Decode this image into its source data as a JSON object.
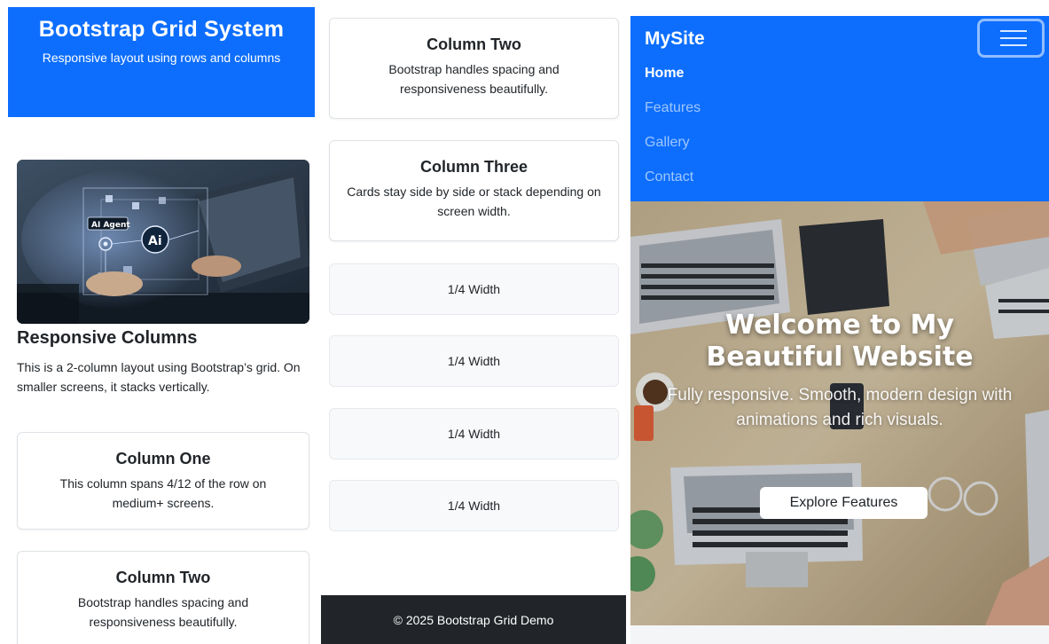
{
  "panel1": {
    "header": {
      "title": "Bootstrap Grid System",
      "subtitle": "Responsive layout using rows and columns"
    },
    "section": {
      "image_labels": [
        "AI Agent",
        "Ai"
      ],
      "title": "Responsive Columns",
      "description": "This is a 2-column layout using Bootstrap’s grid. On smaller screens, it stacks vertically."
    },
    "cards": [
      {
        "title": "Column One",
        "text": "This column spans 4/12 of the row on medium+ screens."
      },
      {
        "title": "Column Two",
        "text": "Bootstrap handles spacing and responsiveness beautifully."
      }
    ]
  },
  "panel2": {
    "cards": [
      {
        "title": "Column Two",
        "text": "Bootstrap handles spacing and responsiveness beautifully."
      },
      {
        "title": "Column Three",
        "text": "Cards stay side by side or stack depending on screen width."
      }
    ],
    "quarters": [
      "1/4 Width",
      "1/4 Width",
      "1/4 Width",
      "1/4 Width"
    ],
    "footer": "© 2025 Bootstrap Grid Demo"
  },
  "panel3": {
    "navbar": {
      "brand": "MySite",
      "toggler_icon": "hamburger-icon",
      "links": [
        "Home",
        "Features",
        "Gallery",
        "Contact"
      ],
      "active": "Home"
    },
    "hero": {
      "title_line1": "Welcome to My",
      "title_line2": "Beautiful Website",
      "subtitle": "Fully responsive. Smooth, modern design with animations and rich visuals.",
      "button": "Explore Features"
    }
  },
  "colors": {
    "primary": "#0d6efd",
    "dark": "#212529",
    "light": "#f8f9fa",
    "border": "#dee2e6"
  }
}
